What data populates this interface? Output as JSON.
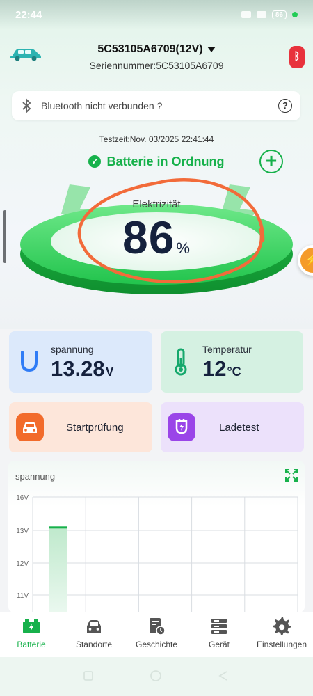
{
  "status_bar": {
    "time": "22:44",
    "battery": "86"
  },
  "header": {
    "device_name": "5C53105A6709(12V)",
    "serial": "Seriennummer:5C53105A6709",
    "bluetooth_badge": "ᛒ"
  },
  "bluetooth_bar": {
    "text": "Bluetooth nicht verbunden ?",
    "help": "?"
  },
  "test_time": "Testzeit:Nov. 03/2025 22:41:44",
  "battery_status": "Batterie in Ordnung",
  "gauge": {
    "label": "Elektrizität",
    "value": "86",
    "unit": "%"
  },
  "cards": {
    "voltage": {
      "label": "spannung",
      "value": "13.28",
      "unit": "V"
    },
    "temperature": {
      "label": "Temperatur",
      "value": "12",
      "unit": "°C"
    }
  },
  "actions": {
    "start_test": "Startprüfung",
    "charge_test": "Ladetest"
  },
  "chart_data": {
    "type": "bar",
    "title": "spannung",
    "y_ticks": [
      "16V",
      "13V",
      "12V",
      "11V"
    ],
    "values": [
      13.1
    ],
    "series": [
      {
        "name": "",
        "values": [
          13.1
        ]
      }
    ],
    "color": "#17b14b"
  },
  "nav": {
    "items": [
      {
        "label": "Batterie",
        "icon": "battery-icon",
        "active": true
      },
      {
        "label": "Standorte",
        "icon": "car-icon",
        "active": false
      },
      {
        "label": "Geschichte",
        "icon": "history-icon",
        "active": false
      },
      {
        "label": "Gerät",
        "icon": "server-icon",
        "active": false
      },
      {
        "label": "Einstellungen",
        "icon": "gear-icon",
        "active": false
      }
    ]
  },
  "colors": {
    "accent": "#17b14b",
    "danger": "#e8323c",
    "annotation": "#f26b3a"
  }
}
